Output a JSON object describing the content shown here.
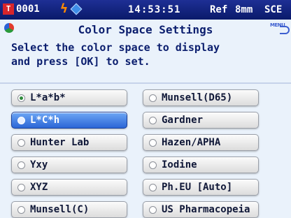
{
  "status_bar": {
    "sample_number": "0001",
    "sample_icon_glyph": "T",
    "time": "14:53:51",
    "ref_label": "Ref",
    "aperture": "8mm",
    "mode": "SCE",
    "icons": [
      "flash-icon",
      "diamond-icon"
    ]
  },
  "header": {
    "title": "Color Space Settings",
    "menu_label": "MENU"
  },
  "instructions": {
    "line1": "Select the color space to display",
    "line2": "and press [OK] to set."
  },
  "options": {
    "left": [
      {
        "label": "L*a*b*",
        "checked": true,
        "selected": false
      },
      {
        "label": "L*C*h",
        "checked": false,
        "selected": true
      },
      {
        "label": "Hunter Lab",
        "checked": false,
        "selected": false
      },
      {
        "label": "Yxy",
        "checked": false,
        "selected": false
      },
      {
        "label": "XYZ",
        "checked": false,
        "selected": false
      },
      {
        "label": "Munsell(C)",
        "checked": false,
        "selected": false
      }
    ],
    "right": [
      {
        "label": "Munsell(D65)",
        "checked": false,
        "selected": false
      },
      {
        "label": "Gardner",
        "checked": false,
        "selected": false
      },
      {
        "label": "Hazen/APHA",
        "checked": false,
        "selected": false
      },
      {
        "label": "Iodine",
        "checked": false,
        "selected": false
      },
      {
        "label": "Ph.EU [Auto]",
        "checked": false,
        "selected": false
      },
      {
        "label": "US Pharmacopeia",
        "checked": false,
        "selected": false
      }
    ]
  },
  "colors": {
    "accent_selected": "#2b66d6",
    "background": "#0b1e6e",
    "panel": "#eaf2fb",
    "text_dark": "#0b1e6e"
  }
}
